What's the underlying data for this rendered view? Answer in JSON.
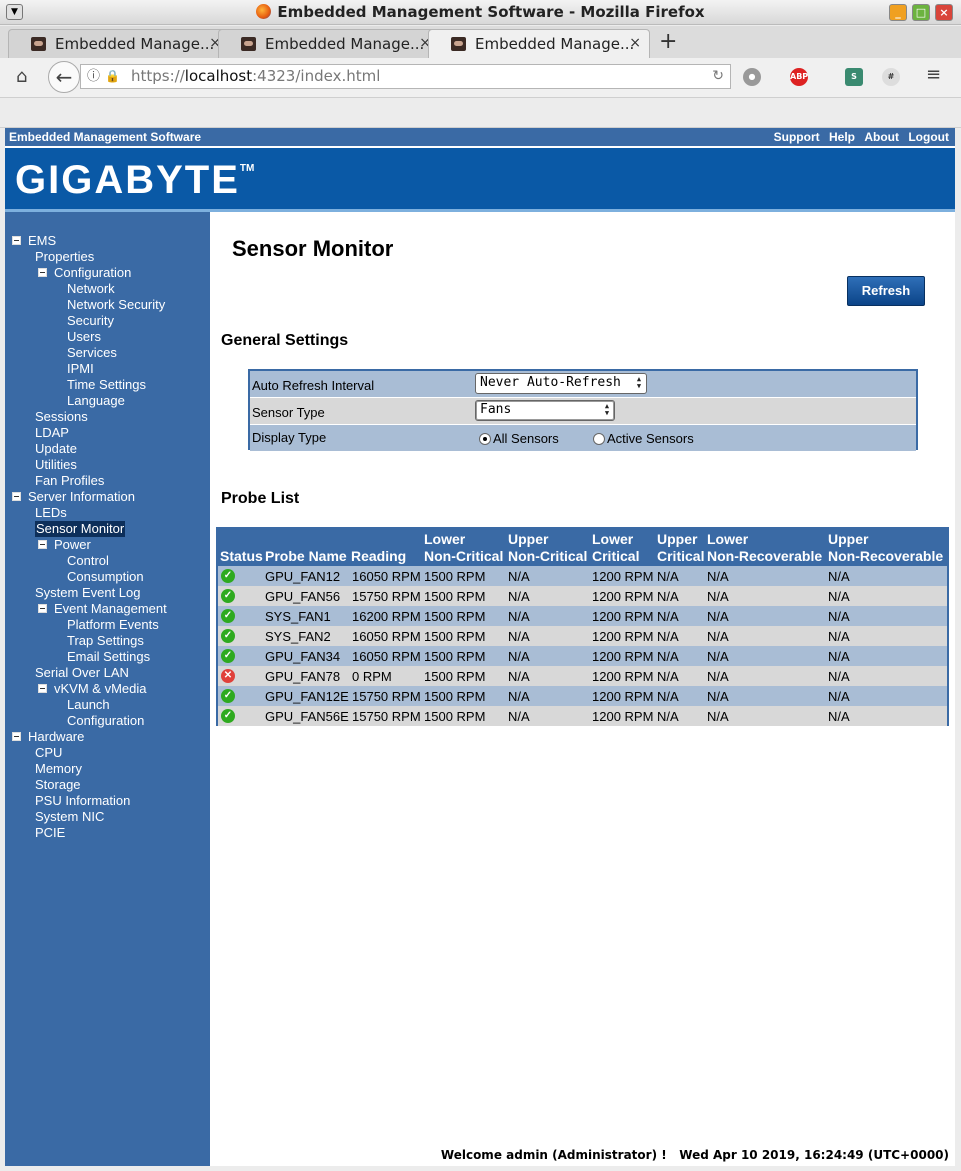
{
  "browser": {
    "window_title": "Embedded Management Software - Mozilla Firefox",
    "tabs": [
      {
        "label": "Embedded Manage...",
        "active": false
      },
      {
        "label": "Embedded Manage...",
        "active": false
      },
      {
        "label": "Embedded Manage...",
        "active": true
      }
    ],
    "url_scheme": "https://",
    "url_host": "localhost",
    "url_rest": ":4323/index.html"
  },
  "header": {
    "app_name": "Embedded Management Software",
    "links": [
      "Support",
      "Help",
      "About",
      "Logout"
    ],
    "brand": "GIGABYTE",
    "tm": "TM"
  },
  "sidebar": {
    "items": [
      {
        "label": "EMS",
        "level": 0,
        "toggle": true
      },
      {
        "label": "Properties",
        "level": 1
      },
      {
        "label": "Configuration",
        "level": 1,
        "toggle": true
      },
      {
        "label": "Network",
        "level": 2
      },
      {
        "label": "Network Security",
        "level": 2
      },
      {
        "label": "Security",
        "level": 2
      },
      {
        "label": "Users",
        "level": 2
      },
      {
        "label": "Services",
        "level": 2
      },
      {
        "label": "IPMI",
        "level": 2
      },
      {
        "label": "Time Settings",
        "level": 2
      },
      {
        "label": "Language",
        "level": 2
      },
      {
        "label": "Sessions",
        "level": 1
      },
      {
        "label": "LDAP",
        "level": 1
      },
      {
        "label": "Update",
        "level": 1
      },
      {
        "label": "Utilities",
        "level": 1
      },
      {
        "label": "Fan Profiles",
        "level": 1
      },
      {
        "label": "Server Information",
        "level": 0,
        "toggle": true
      },
      {
        "label": "LEDs",
        "level": 1
      },
      {
        "label": "Sensor Monitor",
        "level": 1,
        "selected": true
      },
      {
        "label": "Power",
        "level": 1,
        "toggle": true
      },
      {
        "label": "Control",
        "level": 2
      },
      {
        "label": "Consumption",
        "level": 2
      },
      {
        "label": "System Event Log",
        "level": 1
      },
      {
        "label": "Event Management",
        "level": 1,
        "toggle": true
      },
      {
        "label": "Platform Events",
        "level": 2
      },
      {
        "label": "Trap Settings",
        "level": 2
      },
      {
        "label": "Email Settings",
        "level": 2
      },
      {
        "label": "Serial Over LAN",
        "level": 1
      },
      {
        "label": "vKVM & vMedia",
        "level": 1,
        "toggle": true
      },
      {
        "label": "Launch",
        "level": 2
      },
      {
        "label": "Configuration",
        "level": 2
      },
      {
        "label": "Hardware",
        "level": 0,
        "toggle": true
      },
      {
        "label": "CPU",
        "level": 1
      },
      {
        "label": "Memory",
        "level": 1
      },
      {
        "label": "Storage",
        "level": 1
      },
      {
        "label": "PSU Information",
        "level": 1
      },
      {
        "label": "System NIC",
        "level": 1
      },
      {
        "label": "PCIE",
        "level": 1
      }
    ]
  },
  "main": {
    "title": "Sensor Monitor",
    "refresh_label": "Refresh",
    "general_settings_title": "General Settings",
    "auto_refresh_label": "Auto Refresh Interval",
    "auto_refresh_value": "Never Auto-Refresh",
    "sensor_type_label": "Sensor Type",
    "sensor_type_value": "Fans",
    "display_type_label": "Display Type",
    "display_all_label": "All Sensors",
    "display_active_label": "Active Sensors",
    "display_selected": "All Sensors",
    "probe_list_title": "Probe List",
    "columns": [
      [
        "",
        "Status"
      ],
      [
        "",
        "Probe Name"
      ],
      [
        "",
        "Reading"
      ],
      [
        "Lower",
        "Non-Critical"
      ],
      [
        "Upper",
        "Non-Critical"
      ],
      [
        "Lower",
        "Critical"
      ],
      [
        "Upper",
        "Critical"
      ],
      [
        "Lower",
        "Non-Recoverable"
      ],
      [
        "Upper",
        "Non-Recoverable"
      ]
    ],
    "rows": [
      {
        "status": "ok",
        "name": "GPU_FAN12",
        "reading": "16050 RPM",
        "lnc": "1500 RPM",
        "unc": "N/A",
        "lc": "1200 RPM",
        "uc": "N/A",
        "lnr": "N/A",
        "unr": "N/A"
      },
      {
        "status": "ok",
        "name": "GPU_FAN56",
        "reading": "15750 RPM",
        "lnc": "1500 RPM",
        "unc": "N/A",
        "lc": "1200 RPM",
        "uc": "N/A",
        "lnr": "N/A",
        "unr": "N/A"
      },
      {
        "status": "ok",
        "name": "SYS_FAN1",
        "reading": "16200 RPM",
        "lnc": "1500 RPM",
        "unc": "N/A",
        "lc": "1200 RPM",
        "uc": "N/A",
        "lnr": "N/A",
        "unr": "N/A"
      },
      {
        "status": "ok",
        "name": "SYS_FAN2",
        "reading": "16050 RPM",
        "lnc": "1500 RPM",
        "unc": "N/A",
        "lc": "1200 RPM",
        "uc": "N/A",
        "lnr": "N/A",
        "unr": "N/A"
      },
      {
        "status": "ok",
        "name": "GPU_FAN34",
        "reading": "16050 RPM",
        "lnc": "1500 RPM",
        "unc": "N/A",
        "lc": "1200 RPM",
        "uc": "N/A",
        "lnr": "N/A",
        "unr": "N/A"
      },
      {
        "status": "error",
        "name": "GPU_FAN78",
        "reading": "0 RPM",
        "lnc": "1500 RPM",
        "unc": "N/A",
        "lc": "1200 RPM",
        "uc": "N/A",
        "lnr": "N/A",
        "unr": "N/A"
      },
      {
        "status": "ok",
        "name": "GPU_FAN12E",
        "reading": "15750 RPM",
        "lnc": "1500 RPM",
        "unc": "N/A",
        "lc": "1200 RPM",
        "uc": "N/A",
        "lnr": "N/A",
        "unr": "N/A"
      },
      {
        "status": "ok",
        "name": "GPU_FAN56E",
        "reading": "15750 RPM",
        "lnc": "1500 RPM",
        "unc": "N/A",
        "lc": "1200 RPM",
        "uc": "N/A",
        "lnr": "N/A",
        "unr": "N/A"
      }
    ],
    "colors": {
      "ok": "#2eaa1f",
      "error": "#e0403a",
      "row_a": "#a9bdd5",
      "row_b": "#d8d8d8",
      "header": "#3a6aa5"
    }
  },
  "footer": {
    "welcome": "Welcome admin (Administrator) !",
    "datetime": "Wed Apr 10 2019, 16:24:49 (UTC+0000)"
  }
}
